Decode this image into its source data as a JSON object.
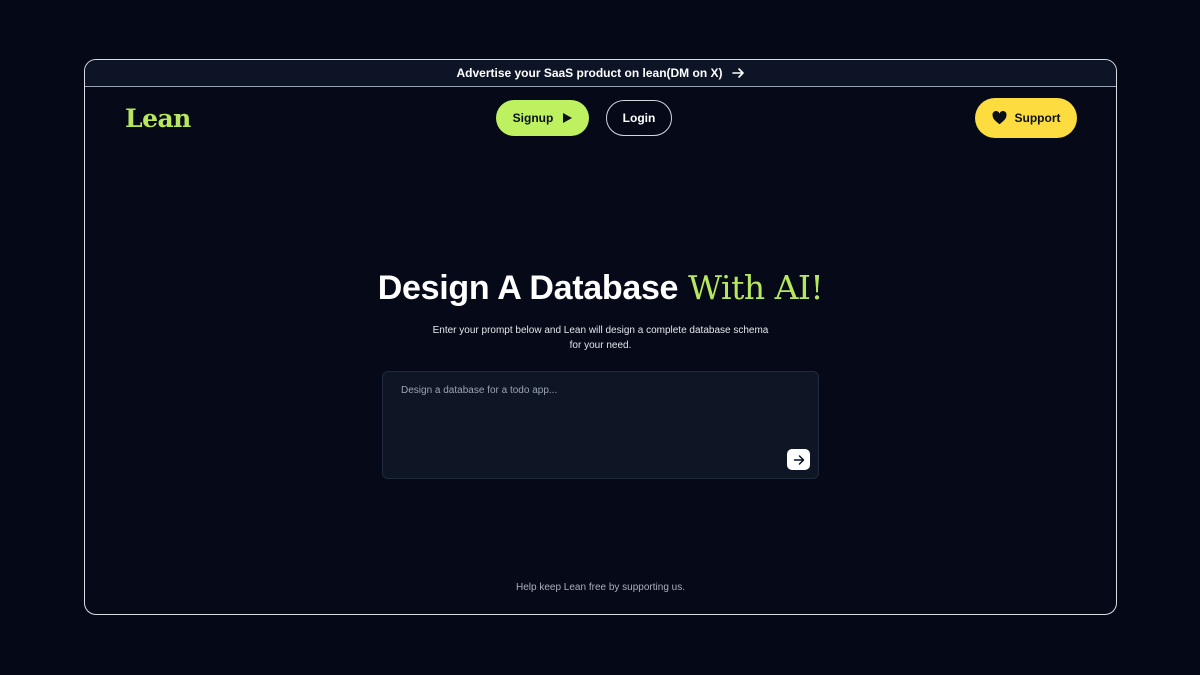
{
  "announcement": {
    "text": "Advertise your SaaS product on lean(DM on X)",
    "icon": "arrow-right-icon"
  },
  "nav": {
    "logo": "Lean",
    "signup_label": "Signup",
    "login_label": "Login",
    "support_label": "Support"
  },
  "hero": {
    "title": "Design A Database",
    "title_accent": "With AI!",
    "subtitle": "Enter your prompt below and Lean will design a complete database schema for your need."
  },
  "prompt": {
    "placeholder": "Design a database for a todo app...",
    "value": ""
  },
  "footer": {
    "note": "Help keep Lean free by supporting us."
  },
  "colors": {
    "background": "#050816",
    "accent_green": "#bdf160",
    "accent_yellow": "#fcdc3f"
  }
}
